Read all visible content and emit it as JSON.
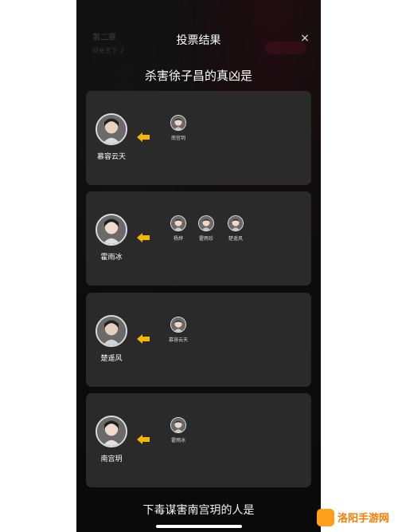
{
  "background": {
    "stage_text": "第二章",
    "sub_text": "阿会天下 2"
  },
  "dialog": {
    "title": "投票结果",
    "close_symbol": "×",
    "question": "杀害徐子昌的真凶是"
  },
  "colors": {
    "card_bg": "#2a2a2a",
    "arrow": "#f5b800",
    "overlay": "#161616"
  },
  "cards": [
    {
      "candidate": "慕容云天",
      "voters": [
        "南宫玥"
      ]
    },
    {
      "candidate": "霍雨冰",
      "voters": [
        "杨烨",
        "霍雨珍",
        "楚遥风"
      ]
    },
    {
      "candidate": "楚遥风",
      "voters": [
        "慕容云天"
      ]
    },
    {
      "candidate": "南宫玥",
      "voters": [
        "霍雨冰"
      ]
    }
  ],
  "footer": {
    "text": "下毒谋害南宫玥的人是"
  },
  "watermark": {
    "brand": "洛阳手游网"
  }
}
